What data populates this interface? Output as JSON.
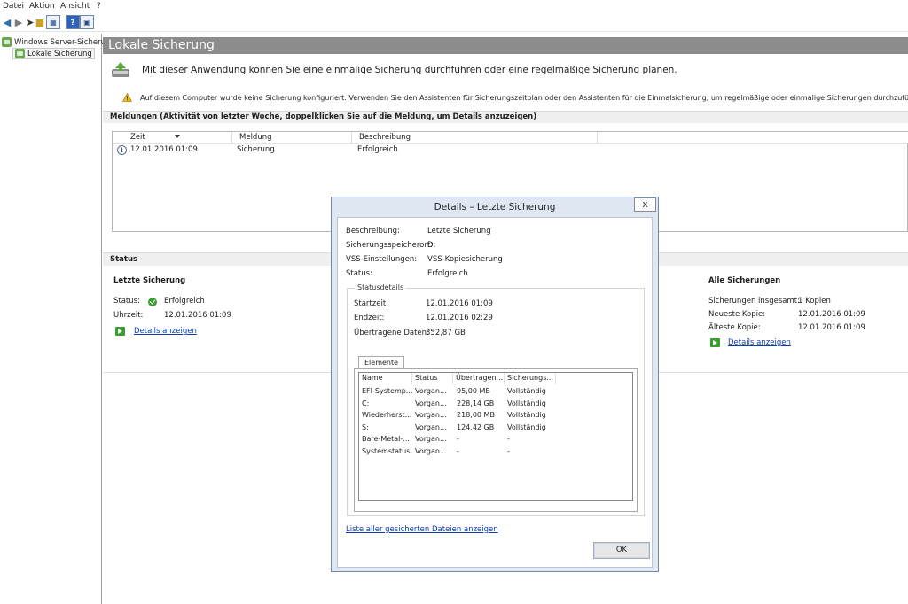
{
  "menu": [
    "Datei",
    "Aktion",
    "Ansicht",
    "?"
  ],
  "toolbar": {
    "back_icon": "back-arrow-icon",
    "forward_icon": "forward-arrow-icon",
    "help_label": "?"
  },
  "tree": {
    "root_label": "Windows Server-Sicherun",
    "child_label": "Lokale Sicherung"
  },
  "pane": {
    "title": "Lokale Sicherung",
    "welcome": "Mit dieser Anwendung können Sie eine einmalige Sicherung durchführen oder eine regelmäßige Sicherung planen.",
    "warning": "Auf diesem Computer wurde keine Sicherung konfiguriert. Verwenden Sie den Assistenten für Sicherungszeitplan oder den Assistenten für die Einmalsicherung, um regelmäßige oder einmalige Sicherungen durchzuführen."
  },
  "messages": {
    "heading": "Meldungen (Aktivität von letzter Woche, doppelklicken Sie auf die Meldung, um Details anzuzeigen)",
    "columns": [
      "Zeit",
      "Meldung",
      "Beschreibung"
    ],
    "rows": [
      {
        "time": "12.01.2016 01:09",
        "message": "Sicherung",
        "description": "Erfolgreich"
      }
    ]
  },
  "status": {
    "heading": "Status",
    "last_backup": {
      "title": "Letzte Sicherung",
      "status_label": "Status:",
      "status_value": "Erfolgreich",
      "time_label": "Uhrzeit:",
      "time_value": "12.01.2016 01:09",
      "details_link": "Details anzeigen"
    },
    "all_backups": {
      "title": "Alle Sicherungen",
      "total_label": "Sicherungen insgesamt:",
      "total_value": "1 Kopien",
      "newest_label": "Neueste Kopie:",
      "newest_value": "12.01.2016 01:09",
      "oldest_label": "Älteste Kopie:",
      "oldest_value": "12.01.2016 01:09",
      "details_link": "Details anzeigen"
    }
  },
  "dialog": {
    "title": "Details – Letzte Sicherung",
    "close_label": "x",
    "fields": [
      {
        "label": "Beschreibung:",
        "value": "Letzte Sicherung"
      },
      {
        "label": "Sicherungsspeicherort:",
        "value": "D:"
      },
      {
        "label": "VSS-Einstellungen:",
        "value": "VSS-Kopiesicherung"
      },
      {
        "label": "Status:",
        "value": "Erfolgreich"
      }
    ],
    "statusdetails": {
      "legend": "Statusdetails",
      "start_label": "Startzeit:",
      "start_value": "12.01.2016 01:09",
      "end_label": "Endzeit:",
      "end_value": "12.01.2016 02:29",
      "transferred_label": "Übertragene Daten:",
      "transferred_value": "352,87 GB",
      "tab": "Elemente",
      "columns": [
        "Name",
        "Status",
        "Übertragen...",
        "Sicherungs..."
      ],
      "rows": [
        {
          "name": "EFI-Systemp...",
          "status": "Vorgan...",
          "transferred": "95,00 MB",
          "type": "Vollständig"
        },
        {
          "name": "C:",
          "status": "Vorgan...",
          "transferred": "228,14 GB",
          "type": "Vollständig"
        },
        {
          "name": "Wiederherst...",
          "status": "Vorgan...",
          "transferred": "218,00 MB",
          "type": "Vollständig"
        },
        {
          "name": "S:",
          "status": "Vorgan...",
          "transferred": "124,42 GB",
          "type": "Vollständig"
        },
        {
          "name": "Bare-Metal-...",
          "status": "Vorgan...",
          "transferred": "-",
          "type": "-"
        },
        {
          "name": "Systemstatus",
          "status": "Vorgan...",
          "transferred": "-",
          "type": "-"
        }
      ]
    },
    "list_link": "Liste aller gesicherten Dateien anzeigen",
    "ok_label": "OK"
  }
}
